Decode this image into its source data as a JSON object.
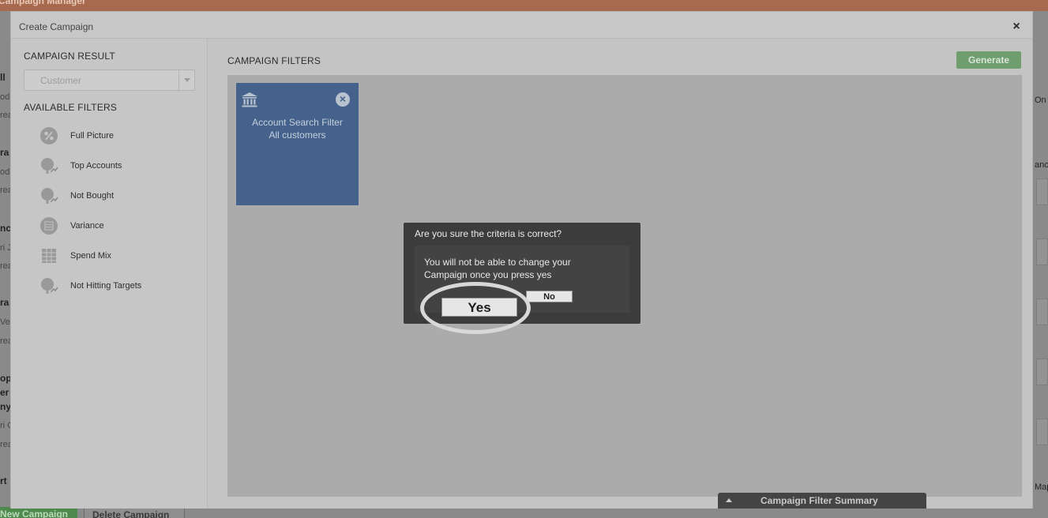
{
  "app": {
    "title": "Campaign Manager",
    "left_fragments": [
      "ll",
      "od",
      "rea",
      "ra",
      "od",
      "rea",
      "nc",
      "ri J",
      "rea",
      "ra",
      "Ved",
      "rea",
      "op",
      "er",
      "nyo",
      "ri C",
      "rea",
      "rt"
    ],
    "right_fragments": [
      "On",
      "anc",
      "Map"
    ],
    "new_campaign_label": "New Campaign",
    "delete_campaign_label": "Delete Campaign"
  },
  "modal": {
    "title": "Create Campaign",
    "close_symbol": "×",
    "sidebar": {
      "result_heading": "CAMPAIGN RESULT",
      "result_value": "Customer",
      "filters_heading": "AVAILABLE FILTERS",
      "filters": [
        {
          "label": "Full Picture",
          "icon": "full-picture-icon"
        },
        {
          "label": "Top Accounts",
          "icon": "top-accounts-icon"
        },
        {
          "label": "Not Bought",
          "icon": "not-bought-icon"
        },
        {
          "label": "Variance",
          "icon": "variance-icon"
        },
        {
          "label": "Spend Mix",
          "icon": "spend-mix-icon"
        },
        {
          "label": "Not Hitting Targets",
          "icon": "not-hitting-targets-icon"
        }
      ]
    },
    "main": {
      "heading": "CAMPAIGN FILTERS",
      "generate_label": "Generate",
      "card": {
        "title": "Account Search Filter",
        "subtitle": "All customers",
        "close_symbol": "×",
        "icon": "bank-icon",
        "color": "#44628b"
      }
    },
    "summary_label": "Campaign Filter Summary"
  },
  "dialog": {
    "title": "Are you sure the criteria is correct?",
    "message": "You will not be able to change your Campaign once you press yes",
    "yes_label": "Yes",
    "no_label": "No"
  }
}
